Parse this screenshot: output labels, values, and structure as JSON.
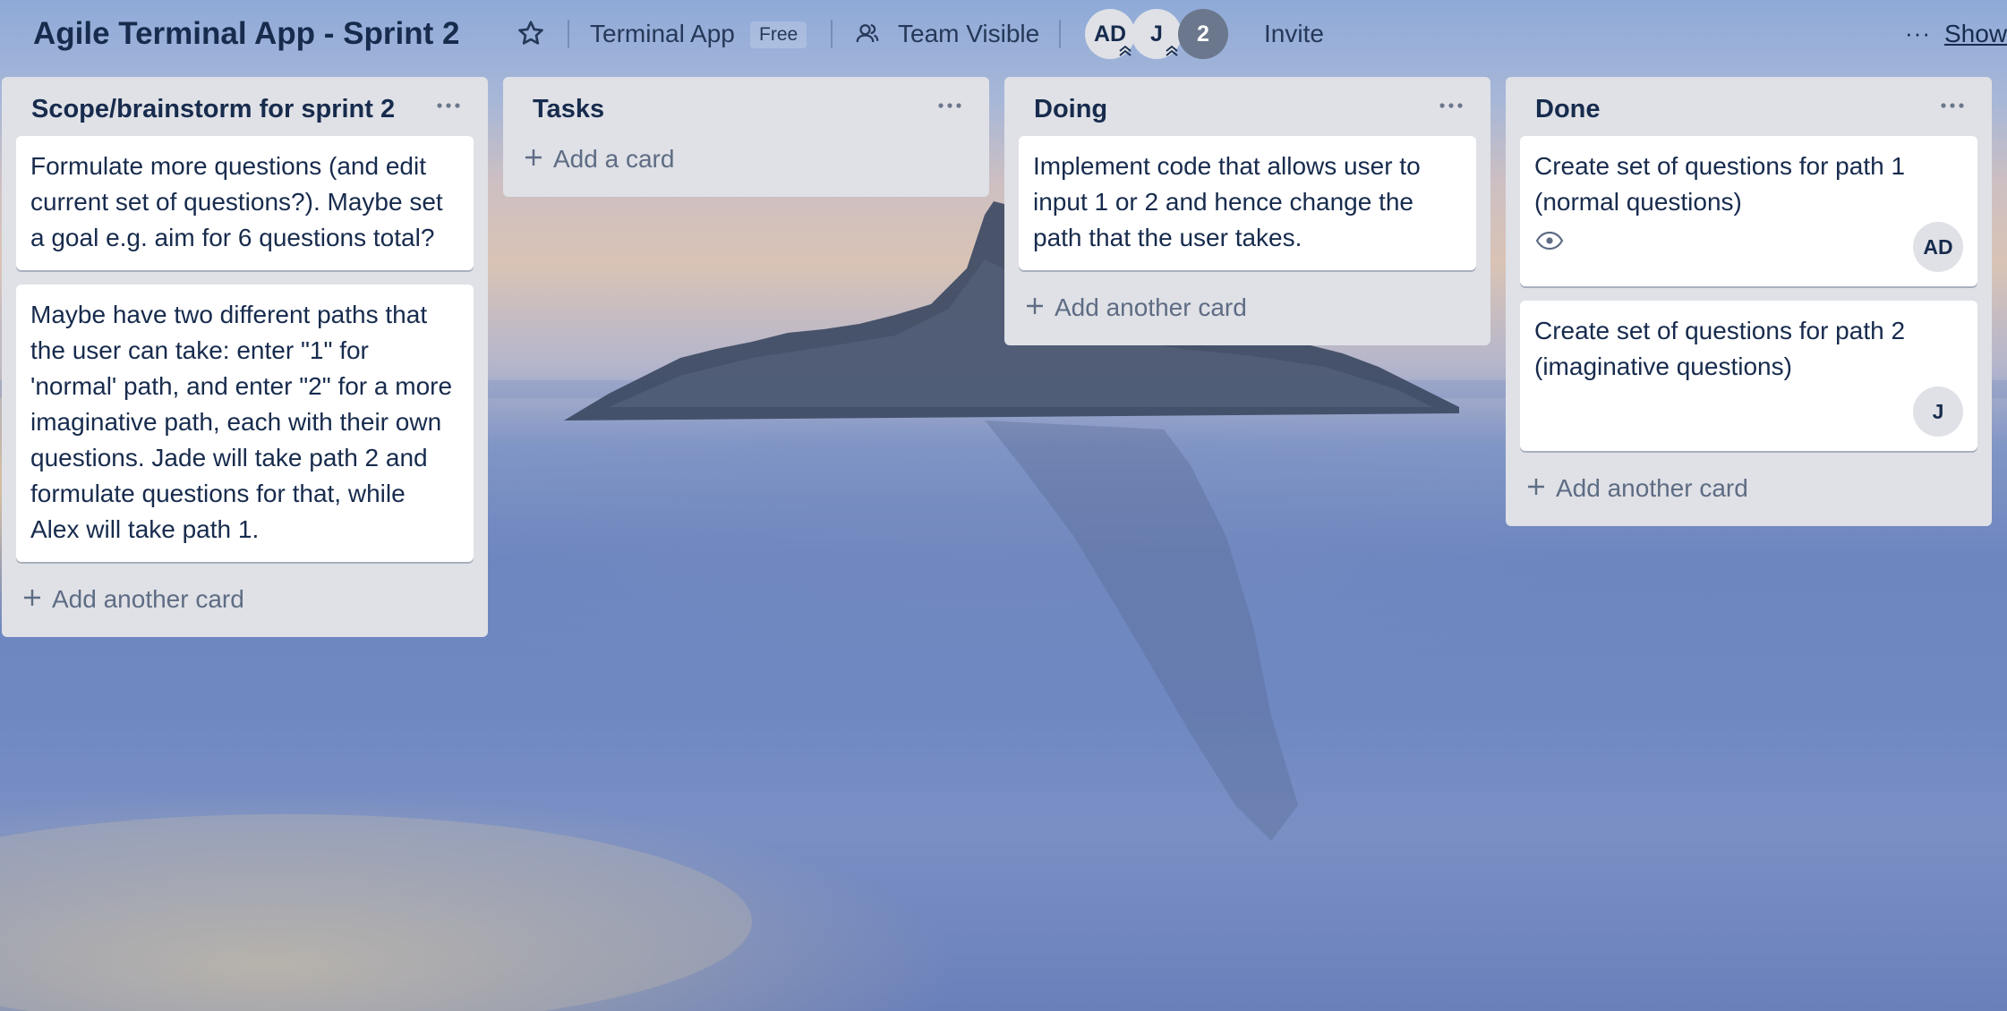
{
  "board": {
    "title": "Agile Terminal App - Sprint 2",
    "workspace": "Terminal App",
    "plan_badge": "Free",
    "visibility": "Team Visible",
    "members": [
      {
        "initials": "AD"
      },
      {
        "initials": "J"
      }
    ],
    "extra_members_count": "2",
    "invite_label": "Invite",
    "show_menu_label": "Show",
    "more_menu_label": "···"
  },
  "lists": [
    {
      "title": "Scope/brainstorm for sprint 2",
      "cards": [
        {
          "text": "Formulate more questions (and edit current set of questions?). Maybe set a goal e.g. aim for 6 questions total?"
        },
        {
          "text": "Maybe have two different paths that the user can take: enter \"1\" for 'normal' path, and enter \"2\" for a more imaginative path, each with their own questions. Jade will take path 2 and formulate questions for that, while Alex will take path 1."
        }
      ],
      "add_label": "Add another card"
    },
    {
      "title": "Tasks",
      "cards": [],
      "add_label": "Add a card"
    },
    {
      "title": "Doing",
      "cards": [
        {
          "text": "Implement code that allows user to input 1 or 2 and hence change the path that the user takes."
        }
      ],
      "add_label": "Add another card"
    },
    {
      "title": "Done",
      "cards": [
        {
          "text": "Create set of questions for path 1 (normal questions)",
          "watching": true,
          "member": "AD"
        },
        {
          "text": "Create set of questions for path 2 (imaginative questions)",
          "member": "J"
        }
      ],
      "add_label": "Add another card"
    }
  ],
  "colors": {
    "list_bg": "#dfe1e6",
    "card_bg": "#ffffff",
    "text": "#172b4d",
    "muted_text": "#5e6c84",
    "avatar_bg": "#dfe1e6",
    "count_badge_bg": "#6b778c"
  },
  "icons": {
    "star": "star-icon",
    "team": "team-icon",
    "list_menu": "ellipsis-icon",
    "add": "plus-icon",
    "watch": "eye-icon",
    "admin_badge": "chevron-up-double-icon"
  }
}
